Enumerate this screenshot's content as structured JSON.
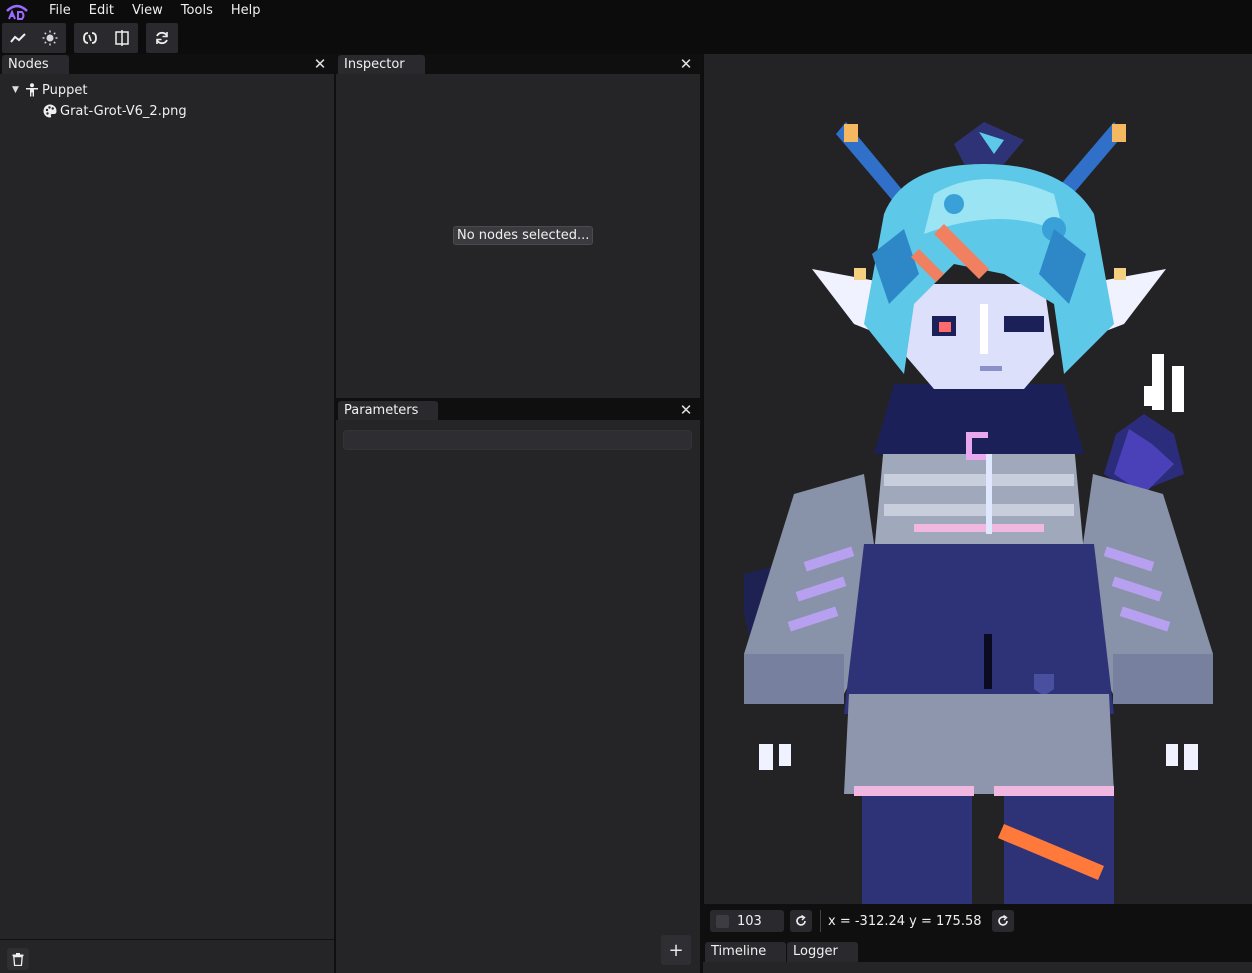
{
  "menu": {
    "items": [
      "File",
      "Edit",
      "View",
      "Tools",
      "Help"
    ]
  },
  "toolbar": {
    "groups": [
      [
        "graph-icon",
        "sun-icon"
      ],
      [
        "link-icon",
        "mirror-icon"
      ],
      [
        "refresh-icon"
      ]
    ]
  },
  "nodes_panel": {
    "title": "Nodes",
    "tree": [
      {
        "label": "Puppet",
        "icon": "puppet-icon",
        "expanded": true
      },
      {
        "label": "Grat-Grot-V6_2.png",
        "icon": "palette-icon"
      }
    ]
  },
  "inspector_panel": {
    "title": "Inspector",
    "empty_message": "No nodes selected..."
  },
  "parameters_panel": {
    "title": "Parameters",
    "search_value": "",
    "add_label": "+"
  },
  "viewport": {
    "zoom": "103",
    "coords": "x = -312.24 y = 175.58"
  },
  "bottom_tabs": [
    "Timeline",
    "Logger"
  ],
  "colors": {
    "accent": "#9b6bff",
    "hair": "#5ec8e8",
    "body": "#2e3378"
  }
}
